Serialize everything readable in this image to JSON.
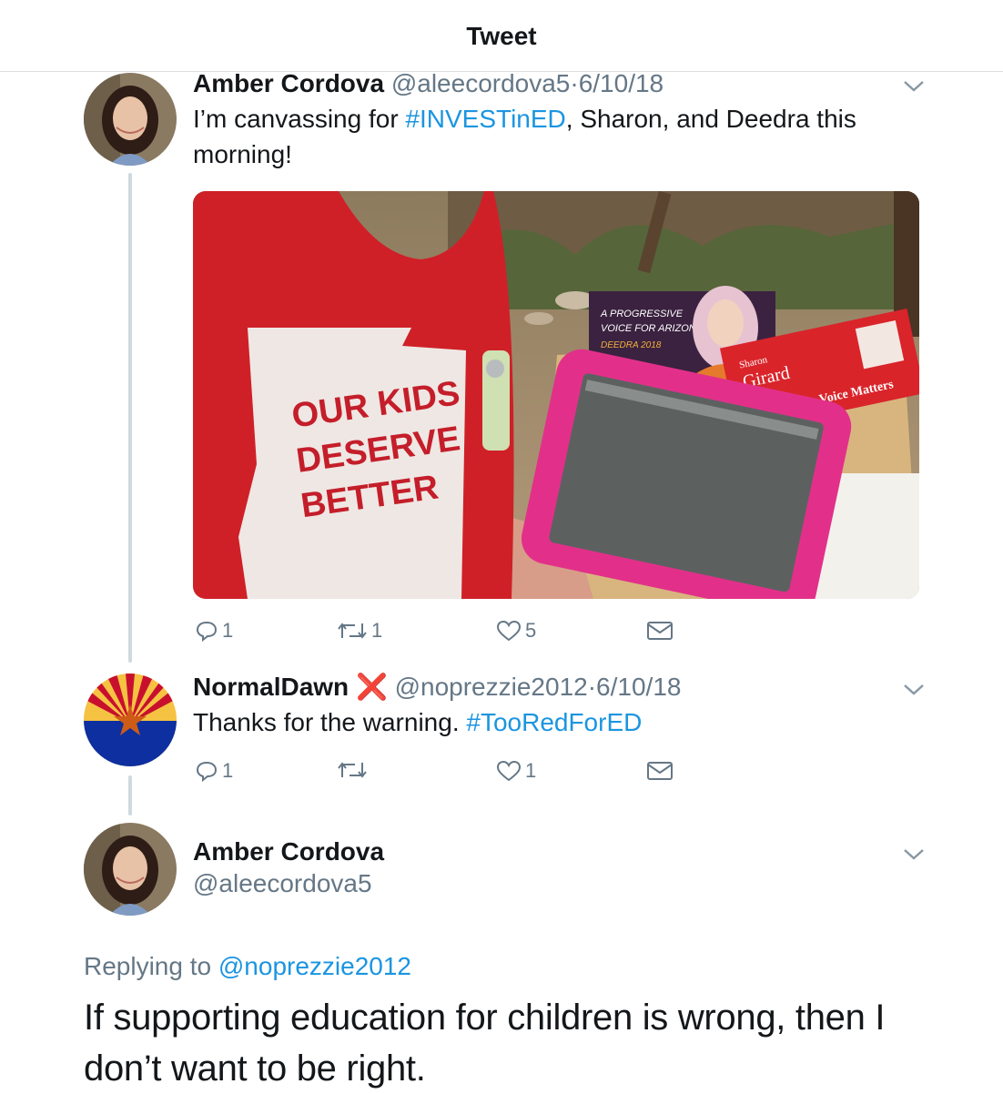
{
  "header": {
    "title": "Tweet"
  },
  "tweets": [
    {
      "name": "Amber Cordova",
      "handle": "@aleecordova5",
      "date": "6/10/18",
      "text_before": "I’m canvassing for ",
      "hashtag": "#INVESTinED",
      "text_after": ", Sharon, and Deedra this morning!",
      "actions": {
        "replies": "1",
        "retweets": "1",
        "likes": "5"
      },
      "media": {
        "shirt_text": [
          "OUR KIDS",
          "DESERVE",
          "BETTER"
        ],
        "card_deedra": [
          "A PROGRESSIVE",
          "VOICE FOR ARIZONA",
          "DEEDRA 2018"
        ],
        "card_sharon": [
          "Sharon",
          "Girard",
          "Voice Matters"
        ]
      }
    },
    {
      "name": "NormalDawn",
      "badge": "❌",
      "handle": "@noprezzie2012",
      "date": "6/10/18",
      "text_before": "Thanks for the warning. ",
      "hashtag": "#TooRedForED",
      "actions": {
        "replies": "1",
        "retweets": "",
        "likes": "1"
      }
    }
  ],
  "main_tweet": {
    "name": "Amber Cordova",
    "handle": "@aleecordova5",
    "replying_label": "Replying to ",
    "replying_handle": "@noprezzie2012",
    "text": "If supporting education for children is wrong, then I don’t want to be right."
  },
  "colors": {
    "link": "#1b95e0",
    "muted": "#657786",
    "badge": "#dd2e44"
  }
}
